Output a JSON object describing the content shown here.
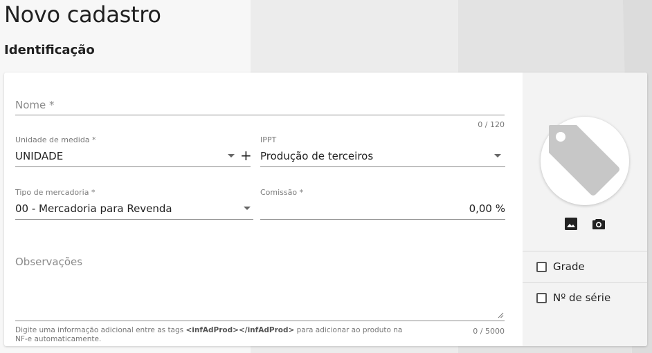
{
  "page": {
    "title": "Novo cadastro",
    "section": "Identificação"
  },
  "form": {
    "nome": {
      "placeholder": "Nome *",
      "counter": "0 / 120"
    },
    "unidade": {
      "label": "Unidade de medida *",
      "value": "UNIDADE",
      "add_label": "+"
    },
    "ippt": {
      "label": "IPPT",
      "value": "Produção de terceiros"
    },
    "tipo": {
      "label": "Tipo de mercadoria *",
      "value": "00 - Mercadoria para Revenda"
    },
    "comissao": {
      "label": "Comissão *",
      "value": "0,00 %"
    },
    "observacoes": {
      "placeholder": "Observações",
      "counter": "0 / 5000",
      "hint_before": "Digite uma informação adicional entre as tags ",
      "hint_tag": "<infAdProd></infAdProd>",
      "hint_after": " para adicionar ao produto na NF-e automaticamente."
    }
  },
  "side": {
    "image_icon": "tag-placeholder-icon",
    "gallery_icon": "image-icon",
    "camera_icon": "camera-icon",
    "options": [
      {
        "label": "Grade",
        "checked": false
      },
      {
        "label": "Nº de série",
        "checked": false
      }
    ]
  }
}
